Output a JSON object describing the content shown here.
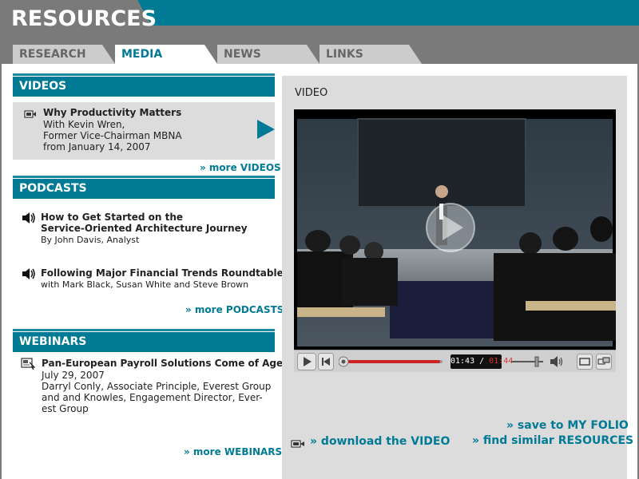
{
  "header": {
    "title": "RESOURCES"
  },
  "tabs": [
    {
      "label": "RESEARCH",
      "active": false
    },
    {
      "label": "MEDIA",
      "active": true
    },
    {
      "label": "NEWS",
      "active": false
    },
    {
      "label": "LINKS",
      "active": false
    }
  ],
  "videos": {
    "heading": "VIDEOS",
    "item": {
      "title": "Why Productivity Matters",
      "lines": [
        "With Kevin Wren,",
        "Former Vice-Chairman MBNA",
        "from January 14, 2007"
      ]
    },
    "more": "» more VIDEOS"
  },
  "podcasts": {
    "heading": "PODCASTS",
    "items": [
      {
        "title_lines": [
          "How to Get Started on the",
          "Service-Oriented Architecture Journey"
        ],
        "byline": "By John Davis, Analyst"
      },
      {
        "title_lines": [
          "Following Major Financial Trends Roundtable"
        ],
        "byline": "with Mark Black, Susan White and Steve Brown"
      }
    ],
    "more": "» more PODCASTS"
  },
  "webinars": {
    "heading": "WEBINARS",
    "item": {
      "title": "Pan-European Payroll Solutions Come of Age",
      "lines": [
        "July 29, 2007",
        "Darryl Conly, Associate Principle, Everest Group",
        "and and Knowles, Engagement Director, Ever-",
        "est Group"
      ]
    },
    "more": "» more WEBINARS"
  },
  "player": {
    "label": "VIDEO",
    "time_current": "01:43",
    "time_sep": " / ",
    "time_total": "01:44",
    "progress": 0.98,
    "volume": 0.8
  },
  "actions": {
    "download": "» download the VIDEO",
    "save": "» save to MY FOLIO",
    "similar": "» find similar RESOURCES"
  },
  "colors": {
    "accent": "#007a95",
    "header_gray": "#7a7a7a",
    "progress_red": "#cc2222"
  }
}
